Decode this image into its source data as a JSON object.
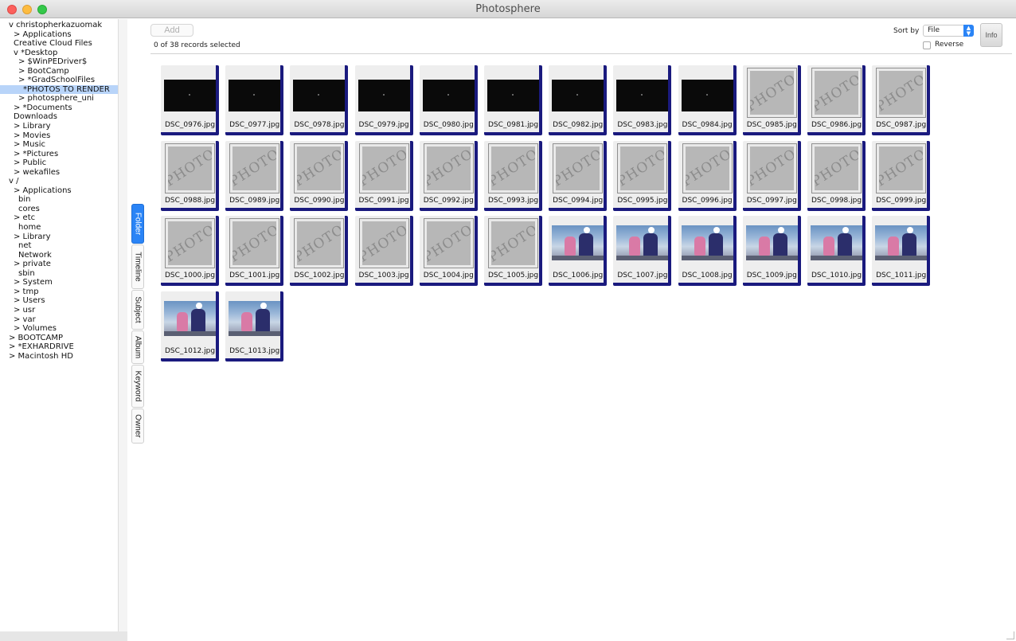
{
  "window": {
    "title": "Photosphere"
  },
  "sidebar": {
    "tree": [
      {
        "label": "v christopherkazuomak",
        "indent": 0
      },
      {
        "label": "> Applications",
        "indent": 1
      },
      {
        "label": "Creative Cloud Files",
        "indent": 1
      },
      {
        "label": "v *Desktop",
        "indent": 1
      },
      {
        "label": "> $WinPEDriver$",
        "indent": 2
      },
      {
        "label": "> BootCamp",
        "indent": 2
      },
      {
        "label": "> *GradSchoolFiles",
        "indent": 2
      },
      {
        "label": "*PHOTOS TO RENDER",
        "indent": 3,
        "selected": true
      },
      {
        "label": "> photosphere_uni",
        "indent": 2
      },
      {
        "label": "> *Documents",
        "indent": 1
      },
      {
        "label": "Downloads",
        "indent": 1
      },
      {
        "label": "> Library",
        "indent": 1
      },
      {
        "label": "> Movies",
        "indent": 1
      },
      {
        "label": "> Music",
        "indent": 1
      },
      {
        "label": "> *Pictures",
        "indent": 1
      },
      {
        "label": "> Public",
        "indent": 1
      },
      {
        "label": "> wekafiles",
        "indent": 1
      },
      {
        "label": "v /",
        "indent": 0
      },
      {
        "label": "> Applications",
        "indent": 1
      },
      {
        "label": "bin",
        "indent": 2
      },
      {
        "label": "cores",
        "indent": 2
      },
      {
        "label": "> etc",
        "indent": 1
      },
      {
        "label": "home",
        "indent": 2
      },
      {
        "label": "> Library",
        "indent": 1
      },
      {
        "label": "net",
        "indent": 2
      },
      {
        "label": "Network",
        "indent": 2
      },
      {
        "label": "> private",
        "indent": 1
      },
      {
        "label": "sbin",
        "indent": 2
      },
      {
        "label": "> System",
        "indent": 1
      },
      {
        "label": "> tmp",
        "indent": 1
      },
      {
        "label": "> Users",
        "indent": 1
      },
      {
        "label": "> usr",
        "indent": 1
      },
      {
        "label": "> var",
        "indent": 1
      },
      {
        "label": "> Volumes",
        "indent": 1
      },
      {
        "label": "> BOOTCAMP",
        "indent": 0
      },
      {
        "label": "> *EXHARDRIVE",
        "indent": 0
      },
      {
        "label": "> Macintosh HD",
        "indent": 0
      }
    ]
  },
  "tabs": [
    {
      "label": "Folder",
      "active": true
    },
    {
      "label": "Timeline"
    },
    {
      "label": "Subject"
    },
    {
      "label": "Album"
    },
    {
      "label": "Keyword"
    },
    {
      "label": "Owner"
    }
  ],
  "toolbar": {
    "add_label": "Add",
    "records_status": "0 of 38 records selected",
    "sort_by_label": "Sort by",
    "sort_value": "File",
    "reverse_label": "Reverse",
    "reverse_checked": false,
    "info_label": "Info"
  },
  "photos": [
    {
      "name": "DSC_0976.jpg",
      "thumb": "dark"
    },
    {
      "name": "DSC_0977.jpg",
      "thumb": "dark"
    },
    {
      "name": "DSC_0978.jpg",
      "thumb": "dark"
    },
    {
      "name": "DSC_0979.jpg",
      "thumb": "dark"
    },
    {
      "name": "DSC_0980.jpg",
      "thumb": "dark"
    },
    {
      "name": "DSC_0981.jpg",
      "thumb": "dark"
    },
    {
      "name": "DSC_0982.jpg",
      "thumb": "dark"
    },
    {
      "name": "DSC_0983.jpg",
      "thumb": "dark"
    },
    {
      "name": "DSC_0984.jpg",
      "thumb": "dark"
    },
    {
      "name": "DSC_0985.jpg",
      "thumb": "placeholder"
    },
    {
      "name": "DSC_0986.jpg",
      "thumb": "placeholder"
    },
    {
      "name": "DSC_0987.jpg",
      "thumb": "placeholder"
    },
    {
      "name": "DSC_0988.jpg",
      "thumb": "placeholder"
    },
    {
      "name": "DSC_0989.jpg",
      "thumb": "placeholder"
    },
    {
      "name": "DSC_0990.jpg",
      "thumb": "placeholder"
    },
    {
      "name": "DSC_0991.jpg",
      "thumb": "placeholder"
    },
    {
      "name": "DSC_0992.jpg",
      "thumb": "placeholder"
    },
    {
      "name": "DSC_0993.jpg",
      "thumb": "placeholder"
    },
    {
      "name": "DSC_0994.jpg",
      "thumb": "placeholder"
    },
    {
      "name": "DSC_0995.jpg",
      "thumb": "placeholder"
    },
    {
      "name": "DSC_0996.jpg",
      "thumb": "placeholder"
    },
    {
      "name": "DSC_0997.jpg",
      "thumb": "placeholder"
    },
    {
      "name": "DSC_0998.jpg",
      "thumb": "placeholder"
    },
    {
      "name": "DSC_0999.jpg",
      "thumb": "placeholder"
    },
    {
      "name": "DSC_1000.jpg",
      "thumb": "placeholder"
    },
    {
      "name": "DSC_1001.jpg",
      "thumb": "placeholder"
    },
    {
      "name": "DSC_1002.jpg",
      "thumb": "placeholder"
    },
    {
      "name": "DSC_1003.jpg",
      "thumb": "placeholder"
    },
    {
      "name": "DSC_1004.jpg",
      "thumb": "placeholder"
    },
    {
      "name": "DSC_1005.jpg",
      "thumb": "placeholder"
    },
    {
      "name": "DSC_1006.jpg",
      "thumb": "photo"
    },
    {
      "name": "DSC_1007.jpg",
      "thumb": "photo"
    },
    {
      "name": "DSC_1008.jpg",
      "thumb": "photo"
    },
    {
      "name": "DSC_1009.jpg",
      "thumb": "photo"
    },
    {
      "name": "DSC_1010.jpg",
      "thumb": "photo"
    },
    {
      "name": "DSC_1011.jpg",
      "thumb": "photo"
    },
    {
      "name": "DSC_1012.jpg",
      "thumb": "photo"
    },
    {
      "name": "DSC_1013.jpg",
      "thumb": "photo"
    }
  ],
  "placeholder_text": "PHOTO",
  "colors": {
    "accent": "#2a84f6",
    "tile_shadow": "#1a1a7e",
    "selection": "#b8d4f9"
  }
}
